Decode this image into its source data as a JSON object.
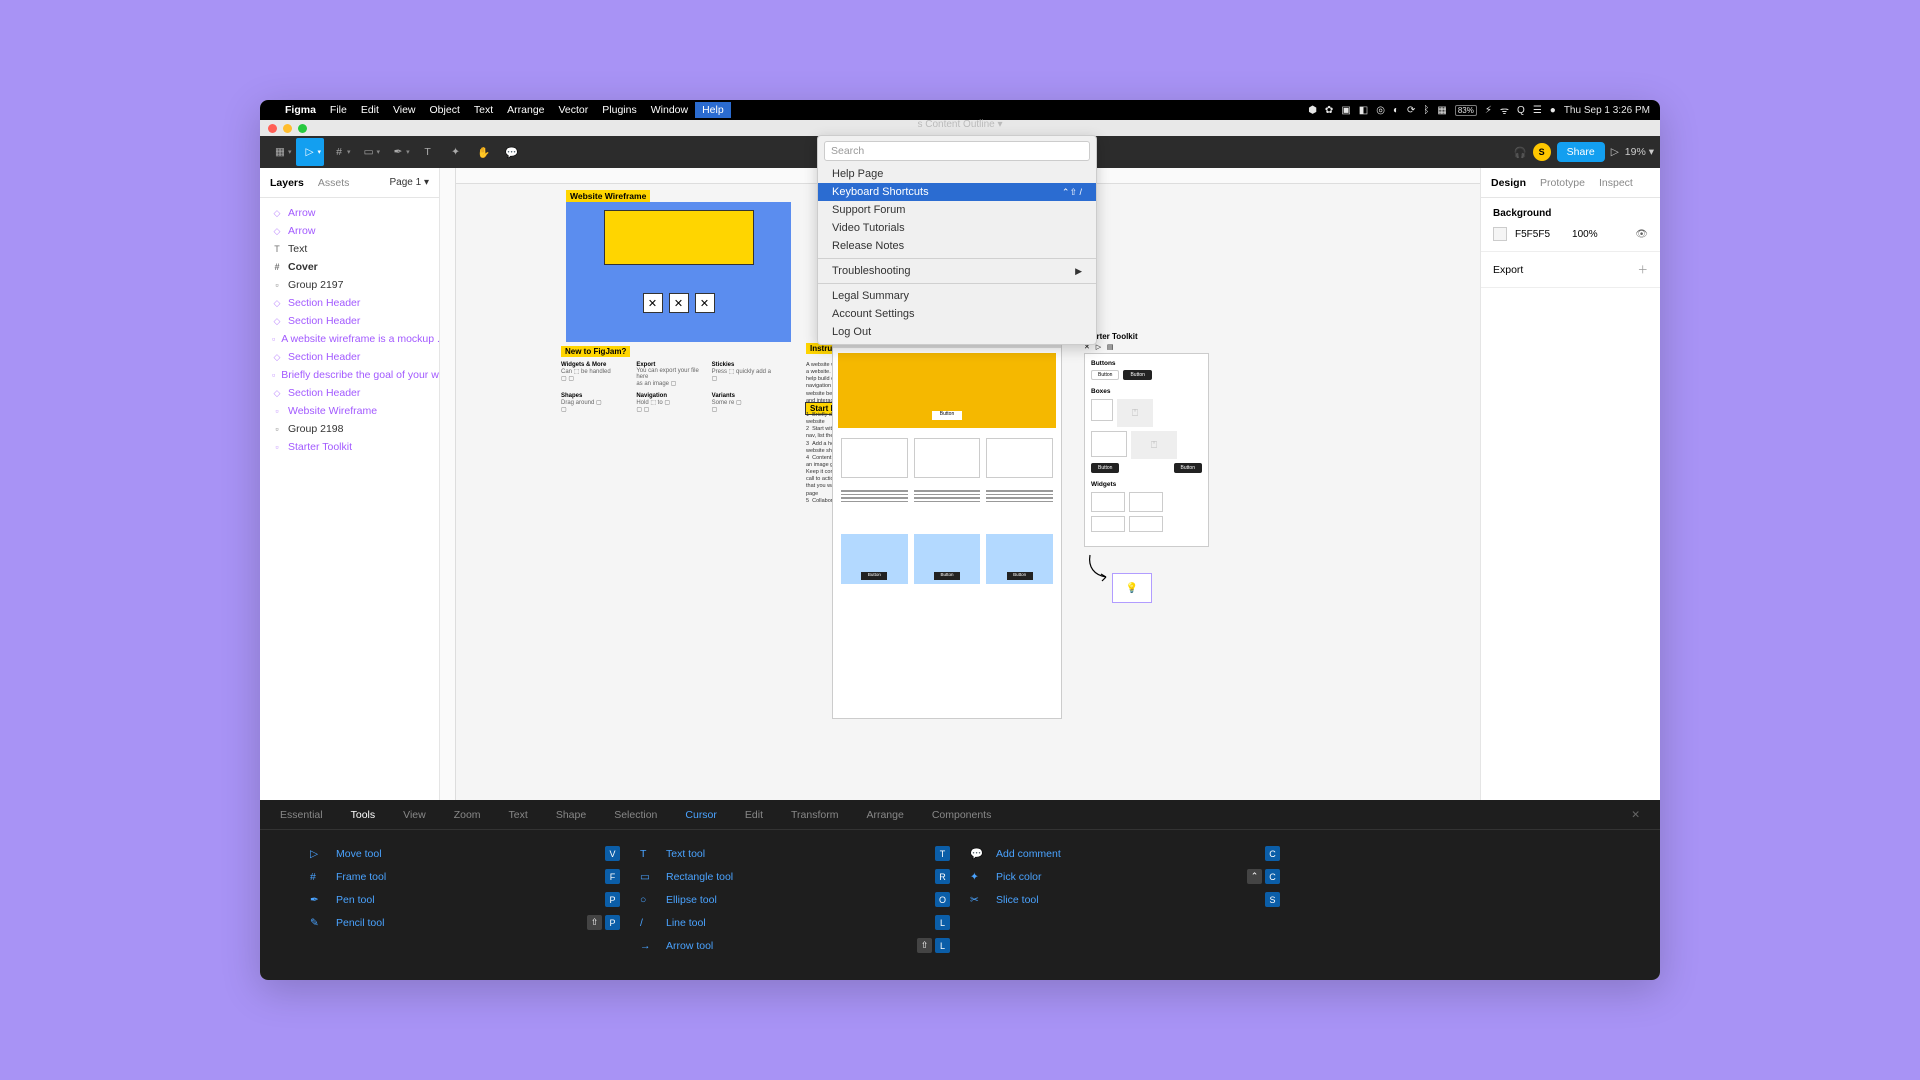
{
  "mac_menu": {
    "app": "Figma",
    "items": [
      "File",
      "Edit",
      "View",
      "Object",
      "Text",
      "Arrange",
      "Vector",
      "Plugins",
      "Window",
      "Help"
    ],
    "active_index": 9,
    "clock": "Thu Sep 1  3:26 PM"
  },
  "figbar": {
    "doc_title_suffix": "t Outline",
    "tab_title": "Content Outline",
    "share": "Share",
    "zoom": "19%",
    "avatar_initial": "S"
  },
  "help_menu": {
    "search_placeholder": "Search",
    "items": [
      "Help Page",
      "Keyboard Shortcuts",
      "Support Forum",
      "Video Tutorials",
      "Release Notes"
    ],
    "highlighted_index": 1,
    "shortcut_hint": "⌃⇧ /",
    "troubleshooting": "Troubleshooting",
    "bottom": [
      "Legal Summary",
      "Account Settings",
      "Log Out"
    ]
  },
  "left_panel": {
    "tabs": [
      "Layers",
      "Assets"
    ],
    "page": "Page 1",
    "layers": [
      {
        "icon": "◇",
        "label": "Arrow",
        "c": "p"
      },
      {
        "icon": "◇",
        "label": "Arrow",
        "c": "p"
      },
      {
        "icon": "T",
        "label": "Text",
        "c": "b"
      },
      {
        "icon": "#",
        "label": "Cover",
        "c": "b",
        "bold": true
      },
      {
        "icon": "▫",
        "label": "Group 2197",
        "c": "b"
      },
      {
        "icon": "◇",
        "label": "Section Header",
        "c": "p"
      },
      {
        "icon": "◇",
        "label": "Section Header",
        "c": "p"
      },
      {
        "icon": "▫",
        "label": "A website wireframe is a mockup ...",
        "c": "p"
      },
      {
        "icon": "◇",
        "label": "Section Header",
        "c": "p"
      },
      {
        "icon": "▫",
        "label": "Briefly describe the goal of your w...",
        "c": "p"
      },
      {
        "icon": "◇",
        "label": "Section Header",
        "c": "p"
      },
      {
        "icon": "▫",
        "label": "Website Wireframe",
        "c": "p"
      },
      {
        "icon": "▫",
        "label": "Group 2198",
        "c": "b"
      },
      {
        "icon": "▫",
        "label": "Starter Toolkit",
        "c": "p"
      }
    ]
  },
  "right_panel": {
    "tabs": [
      "Design",
      "Prototype",
      "Inspect"
    ],
    "background": {
      "label": "Background",
      "hex": "F5F5F5",
      "opacity": "100%"
    },
    "export": "Export"
  },
  "canvas": {
    "labels": {
      "website_wireframe": "Website Wireframe",
      "new_to_figjam": "New to FigJam?",
      "instructions": "Instructions",
      "start_here": "Start Here",
      "starter_toolkit": "Starter Toolkit",
      "button": "Button",
      "buttons_h": "Buttons",
      "boxes_h": "Boxes",
      "widgets_h": "Widgets",
      "widgets_more": "Widgets & More",
      "export": "Export",
      "stickies": "Stickies",
      "shapes": "Shapes",
      "navigation": "Navigation",
      "variants": "Variants"
    }
  },
  "shortcuts": {
    "tabs": [
      "Essential",
      "Tools",
      "View",
      "Zoom",
      "Text",
      "Shape",
      "Selection",
      "Cursor",
      "Edit",
      "Transform",
      "Arrange",
      "Components"
    ],
    "active_index": 1,
    "blue_index": 7,
    "cols": [
      [
        {
          "icon": "▷",
          "label": "Move tool",
          "keys": [
            "V"
          ]
        },
        {
          "icon": "#",
          "label": "Frame tool",
          "keys": [
            "F"
          ]
        },
        {
          "icon": "✒",
          "label": "Pen tool",
          "keys": [
            "P"
          ]
        },
        {
          "icon": "✎",
          "label": "Pencil tool",
          "keys": [
            "⇧",
            "P"
          ]
        }
      ],
      [
        {
          "icon": "T",
          "label": "Text tool",
          "keys": [
            "T"
          ]
        },
        {
          "icon": "▭",
          "label": "Rectangle tool",
          "keys": [
            "R"
          ]
        },
        {
          "icon": "○",
          "label": "Ellipse tool",
          "keys": [
            "O"
          ]
        },
        {
          "icon": "/",
          "label": "Line tool",
          "keys": [
            "L"
          ]
        },
        {
          "icon": "→",
          "label": "Arrow tool",
          "keys": [
            "⇧",
            "L"
          ]
        }
      ],
      [
        {
          "icon": "💬",
          "label": "Add comment",
          "keys": [
            "C"
          ]
        },
        {
          "icon": "✦",
          "label": "Pick color",
          "keys": [
            "⌃",
            "C"
          ]
        },
        {
          "icon": "✂",
          "label": "Slice tool",
          "keys": [
            "S"
          ]
        }
      ],
      []
    ]
  }
}
